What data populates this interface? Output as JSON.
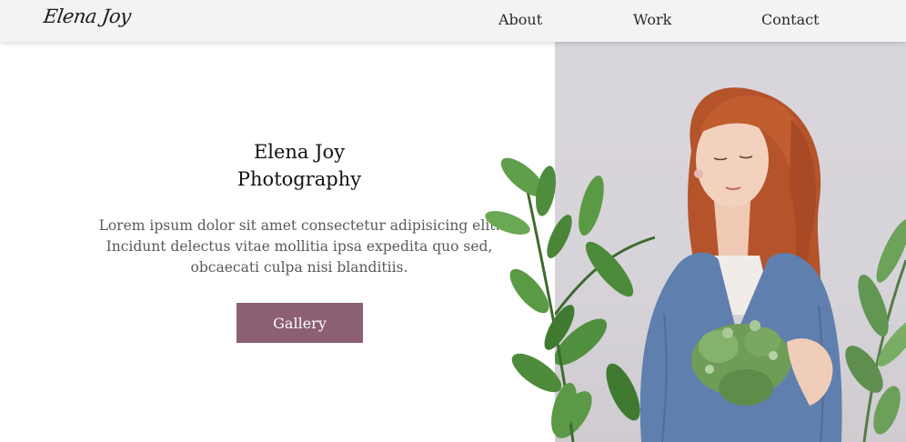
{
  "header": {
    "logo": "Elena Joy",
    "nav": [
      {
        "label": "About"
      },
      {
        "label": "Work"
      },
      {
        "label": "Contact"
      }
    ]
  },
  "hero": {
    "title_line1": "Elena Joy",
    "title_line2": "Photography",
    "description": "Lorem ipsum dolor sit amet consectetur adipisicing elit. Incidunt delectus vitae mollitia ipsa expedita quo sed, obcaecati culpa nisi blanditiis.",
    "button_label": "Gallery"
  },
  "colors": {
    "button": "#8c5f72",
    "navbar": "#f3f3f3",
    "photo_background": "#d8d5db",
    "sweater": "#5f7fae",
    "hair": "#b5532a",
    "foliage": "#4f8a3a"
  }
}
